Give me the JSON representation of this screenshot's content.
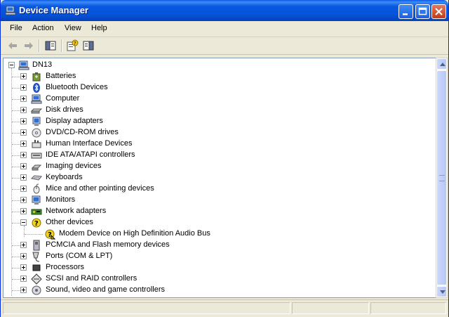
{
  "window": {
    "title": "Device Manager"
  },
  "menu": [
    "File",
    "Action",
    "View",
    "Help"
  ],
  "toolbar": {
    "icons": [
      "back-arrow-icon",
      "forward-arrow-icon",
      "show-hide-console-tree-icon",
      "properties-help-icon",
      "show-action-pane-icon"
    ]
  },
  "tree": {
    "root": {
      "label": "DN13",
      "icon": "computer-icon"
    },
    "items": [
      {
        "label": "Batteries",
        "icon": "battery-icon",
        "expanded": false
      },
      {
        "label": "Bluetooth Devices",
        "icon": "bluetooth-icon",
        "expanded": false
      },
      {
        "label": "Computer",
        "icon": "computer-icon",
        "expanded": false
      },
      {
        "label": "Disk drives",
        "icon": "disk-drive-icon",
        "expanded": false
      },
      {
        "label": "Display adapters",
        "icon": "display-adapter-icon",
        "expanded": false
      },
      {
        "label": "DVD/CD-ROM drives",
        "icon": "dvd-drive-icon",
        "expanded": false
      },
      {
        "label": "Human Interface Devices",
        "icon": "hid-icon",
        "expanded": false
      },
      {
        "label": "IDE ATA/ATAPI controllers",
        "icon": "ide-controller-icon",
        "expanded": false
      },
      {
        "label": "Imaging devices",
        "icon": "camera-icon",
        "expanded": false
      },
      {
        "label": "Keyboards",
        "icon": "keyboard-icon",
        "expanded": false
      },
      {
        "label": "Mice and other pointing devices",
        "icon": "mouse-icon",
        "expanded": false
      },
      {
        "label": "Monitors",
        "icon": "monitor-icon",
        "expanded": false
      },
      {
        "label": "Network adapters",
        "icon": "network-adapter-icon",
        "expanded": false
      },
      {
        "label": "Other devices",
        "icon": "unknown-device-icon",
        "expanded": true,
        "children": [
          {
            "label": "Modem Device on High Definition Audio Bus",
            "icon": "warning-device-icon"
          }
        ]
      },
      {
        "label": "PCMCIA and Flash memory devices",
        "icon": "pcmcia-icon",
        "expanded": false
      },
      {
        "label": "Ports (COM & LPT)",
        "icon": "port-icon",
        "expanded": false
      },
      {
        "label": "Processors",
        "icon": "processor-icon",
        "expanded": false
      },
      {
        "label": "SCSI and RAID controllers",
        "icon": "scsi-icon",
        "expanded": false
      },
      {
        "label": "Sound, video and game controllers",
        "icon": "sound-icon",
        "expanded": false
      }
    ]
  },
  "colors": {
    "titlebar": "#0858e0",
    "selection": "#316ac5"
  }
}
